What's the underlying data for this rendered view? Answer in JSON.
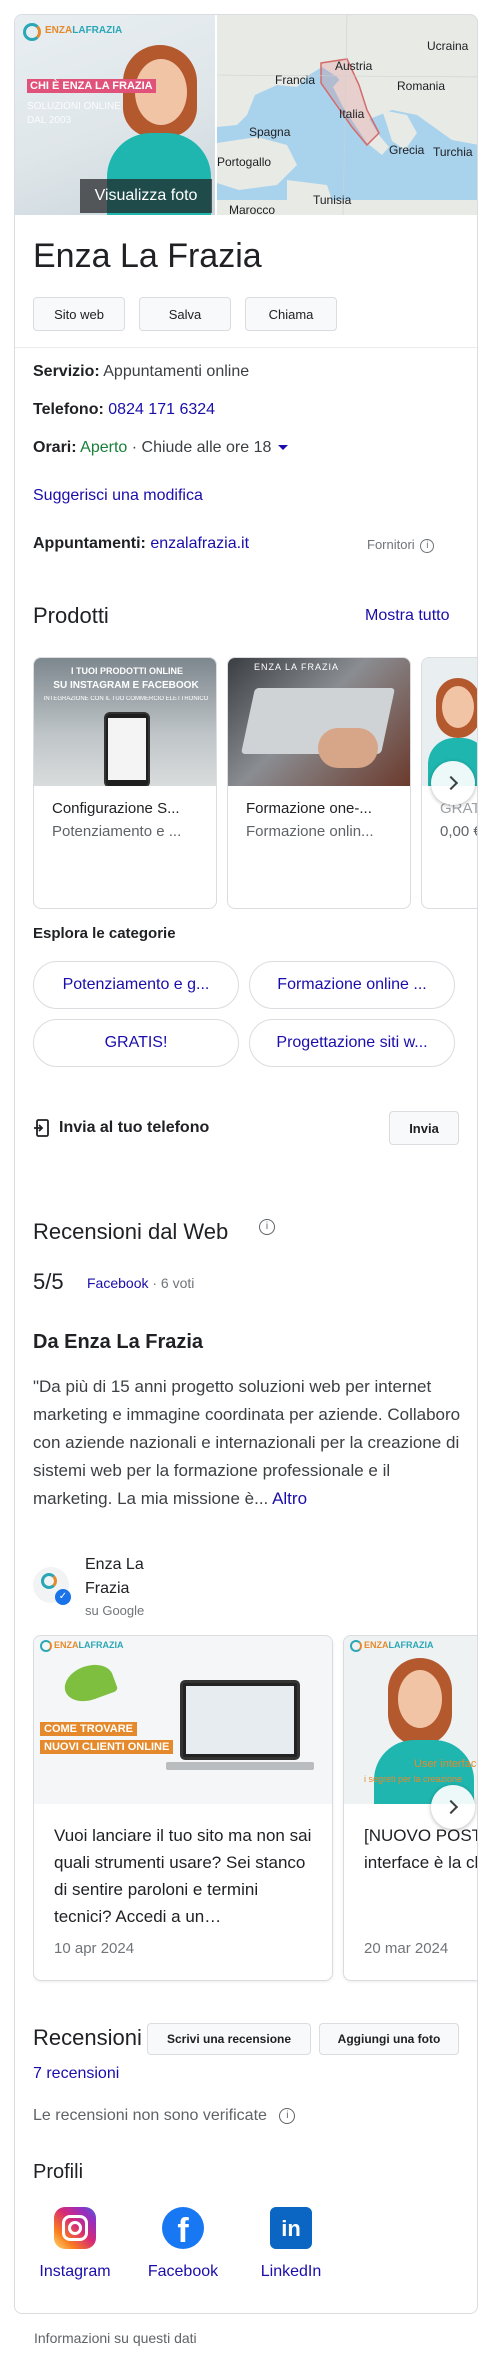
{
  "hero": {
    "promo_line1": "CHI È ENZA LA FRAZIA",
    "promo_line2": "SOLUZIONI ONLINE",
    "promo_line3": "DAL 2003",
    "view_photos": "Visualizza foto",
    "brand_part1": "ENZA",
    "brand_part2": "LAFRAZIA",
    "map_labels": {
      "ukraine": "Ucraina",
      "france": "Francia",
      "austria": "Austria",
      "romania": "Romania",
      "spain": "Spagna",
      "italy": "Italia",
      "portugal": "Portogallo",
      "greece": "Grecia",
      "turkey": "Turchia",
      "tunisia": "Tunisia",
      "morocco": "Marocco"
    }
  },
  "business": {
    "name": "Enza La Frazia",
    "actions": [
      "Sito web",
      "Salva",
      "Chiama"
    ],
    "service_label": "Servizio:",
    "service_value": "Appuntamenti online",
    "phone_label": "Telefono:",
    "phone_value": "0824 171 6324",
    "hours_label": "Orari:",
    "hours_status": "Aperto",
    "hours_detail": "· Chiude alle ore 18",
    "suggest_edit": "Suggerisci una modifica",
    "appointments_label": "Appuntamenti:",
    "appointments_value": "enzalafrazia.it",
    "providers": "Fornitori"
  },
  "products": {
    "title": "Prodotti",
    "show_all": "Mostra tutto",
    "items": [
      {
        "title": "Configurazione S...",
        "subtitle": "Potenziamento e ...",
        "image_line1": "I TUOI PRODOTTI ONLINE",
        "image_line2": "SU INSTAGRAM E FACEBOOK",
        "image_line3": "INTEGRAZIONE CON IL TUO COMMERCIO ELETTRONICO"
      },
      {
        "title": "Formazione one-...",
        "subtitle": "Formazione onlin...",
        "image_brand": "ENZA LA FRAZIA"
      },
      {
        "title": "GRAT",
        "subtitle": "0,00 €"
      }
    ],
    "categories_title": "Esplora le categorie",
    "categories": [
      "Potenziamento e g...",
      "Formazione online ...",
      "GRATIS!",
      "Progettazione siti w..."
    ]
  },
  "send": {
    "label": "Invia al tuo telefono",
    "button": "Invia"
  },
  "reviews_web": {
    "title": "Recensioni dal Web",
    "score": "5/5",
    "source": "Facebook",
    "votes": "· 6 voti"
  },
  "from_business": {
    "title": "Da Enza La Frazia",
    "description": "\"Da più di 15 anni progetto soluzioni web per internet marketing e immagine coordinata per aziende. Collaboro con aziende nazionali e internazionali per la creazione di sistemi web per la formazione professionale e il marketing. La mia missione è...",
    "more": "Altro",
    "author_name_line1": "Enza La",
    "author_name_line2": "Frazia",
    "author_source": "su Google",
    "posts": [
      {
        "image_line1": "COME TROVARE",
        "image_line2": "NUOVI CLIENTI ONLINE",
        "text": "Vuoi lanciare il tuo sito ma non sai quali strumenti usare? Sei stanco di sentire paroloni e termini tecnici? Accedi a un…",
        "date": "10 apr 2024"
      },
      {
        "image_line1": "User interface e",
        "image_line2": "i segreti per la creazione",
        "text": "[NUOVO POST] ENZALAFRAZIA interface è la ch personal brandi",
        "date": "20 mar 2024"
      }
    ]
  },
  "reviews": {
    "title": "Recensioni",
    "write": "Scrivi una recensione",
    "add_photo": "Aggiungi una foto",
    "count": "7 recensioni",
    "unverified": "Le recensioni non sono verificate"
  },
  "profiles": {
    "title": "Profili",
    "items": [
      "Instagram",
      "Facebook",
      "LinkedIn"
    ]
  },
  "footer": {
    "info": "Informazioni su questi dati"
  },
  "colors": {
    "link": "#1a0dab",
    "open_green": "#188038",
    "facebook": "#1877f2",
    "linkedin": "#0a66c2"
  }
}
